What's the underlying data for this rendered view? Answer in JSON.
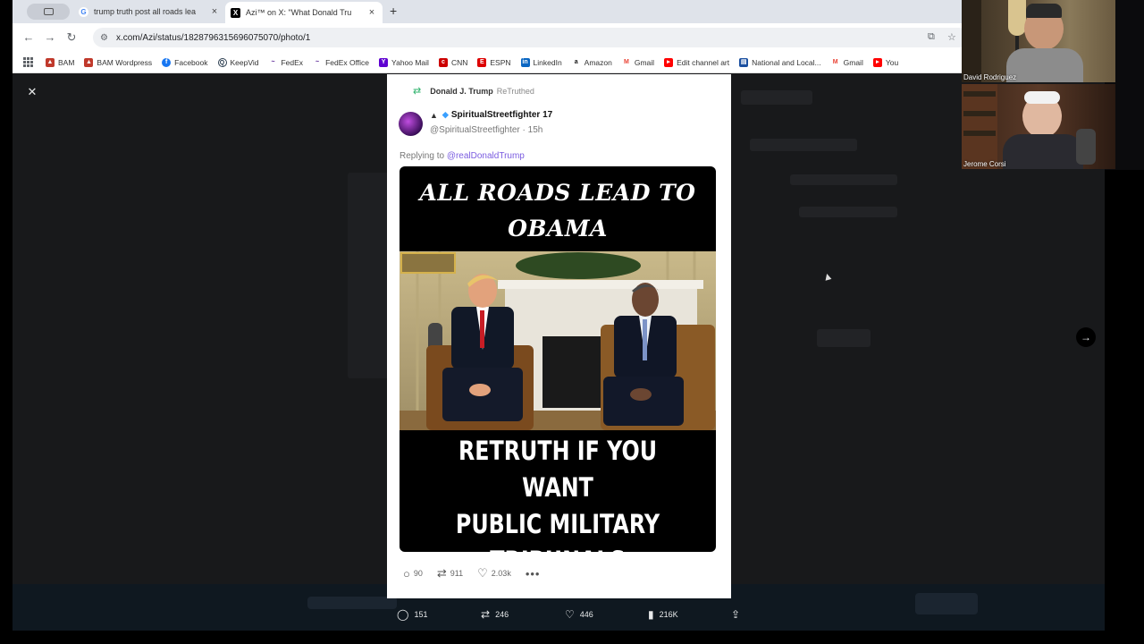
{
  "browser": {
    "tabs": [
      {
        "title": "trump truth post all roads lea",
        "favicon": "G",
        "active": false
      },
      {
        "title": "Azi™ on X: \"What Donald Tru",
        "favicon": "X",
        "active": true
      }
    ],
    "url": "x.com/Azi/status/1828796315696075070/photo/1",
    "bookmarks": [
      {
        "label": "BAM",
        "color": "#c0392b"
      },
      {
        "label": "BAM Wordpress",
        "color": "#c0392b"
      },
      {
        "label": "Facebook",
        "color": "#1877f2"
      },
      {
        "label": "KeepVid",
        "color": "#2c3e50"
      },
      {
        "label": "FedEx",
        "color": "#4d148c"
      },
      {
        "label": "FedEx Office",
        "color": "#4d148c"
      },
      {
        "label": "Yahoo Mail",
        "color": "#5f01d1"
      },
      {
        "label": "CNN",
        "color": "#cc0000"
      },
      {
        "label": "ESPN",
        "color": "#d00"
      },
      {
        "label": "LinkedIn",
        "color": "#0a66c2"
      },
      {
        "label": "Amazon",
        "color": "#111"
      },
      {
        "label": "Gmail",
        "color": "#ea4335"
      },
      {
        "label": "Edit channel art",
        "color": "#ff0000"
      },
      {
        "label": "National and Local...",
        "color": "#1a4fa0"
      },
      {
        "label": "Gmail",
        "color": "#ea4335"
      },
      {
        "label": "You",
        "color": "#ff0000"
      }
    ]
  },
  "post": {
    "retruth_by": "Donald J. Trump",
    "retruth_label": "ReTruthed",
    "display_name": "SpiritualStreetfighter 17",
    "handle_time": "@SpiritualStreetfighter · 15h",
    "replying_prefix": "Replying to",
    "replying_to": "@realDonaldTrump",
    "meme_top_line1": "ALL ROADS LEAD TO",
    "meme_top_line2": "OBAMA",
    "meme_bottom_line1": "RETRUTH IF YOU WANT",
    "meme_bottom_line2": "PUBLIC MILITARY",
    "meme_bottom_line3": "TRIBUNALS",
    "replies": "90",
    "retruths": "911",
    "likes": "2.03k"
  },
  "x_actions": {
    "replies": "151",
    "reposts": "246",
    "likes": "446",
    "views": "216K"
  },
  "video_call": {
    "participant1": "David Rodriguez",
    "participant2": "Jerome Corsi"
  }
}
